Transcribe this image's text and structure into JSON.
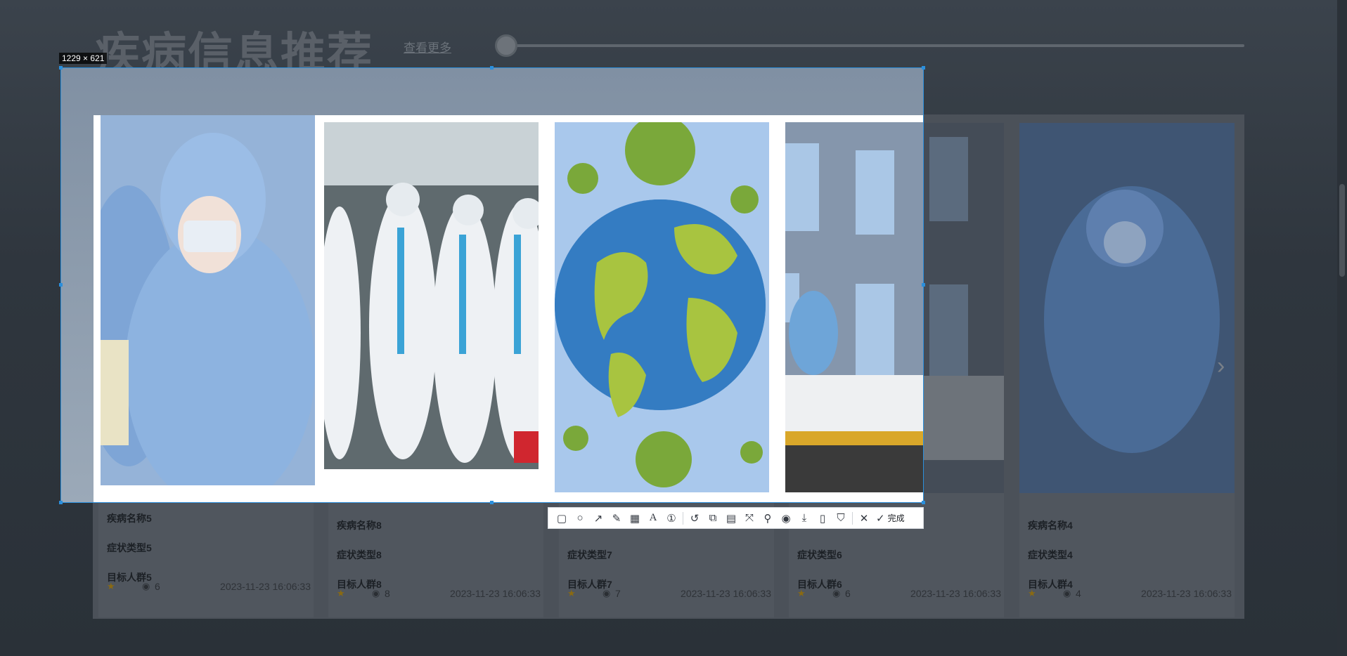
{
  "section": {
    "title": "疾病信息推荐",
    "more_link": "查看更多"
  },
  "cards": [
    {
      "name": "疾病名称5",
      "symptom": "症状类型5",
      "target": "目标人群5",
      "views": "6",
      "date": "2023-11-23 16:06:33"
    },
    {
      "name": "疾病名称8",
      "symptom": "症状类型8",
      "target": "目标人群8",
      "views": "8",
      "date": "2023-11-23 16:06:33"
    },
    {
      "name": "",
      "symptom": "症状类型7",
      "target": "目标人群7",
      "views": "7",
      "date": "2023-11-23 16:06:33"
    },
    {
      "name": "",
      "symptom": "症状类型6",
      "target": "目标人群6",
      "views": "6",
      "date": "2023-11-23 16:06:33"
    },
    {
      "name": "疾病名称4",
      "symptom": "症状类型4",
      "target": "目标人群4",
      "views": "4",
      "date": "2023-11-23 16:06:33"
    }
  ],
  "capture": {
    "size_label": "1229 × 621",
    "done_label": "完成",
    "tools": [
      "select-tool-icon",
      "circle-icon",
      "arrow-icon",
      "pencil-icon",
      "mosaic-icon",
      "text-icon",
      "numbered-marker-icon",
      "undo-icon",
      "screen-record-icon",
      "ocr-icon",
      "long-screenshot-icon",
      "pin-icon",
      "record-icon",
      "download-icon",
      "phone-icon",
      "bookmark-icon",
      "close-icon"
    ]
  },
  "colors": {
    "selection_border": "#2b8fdc",
    "overlay_bg": "#2f363e"
  }
}
